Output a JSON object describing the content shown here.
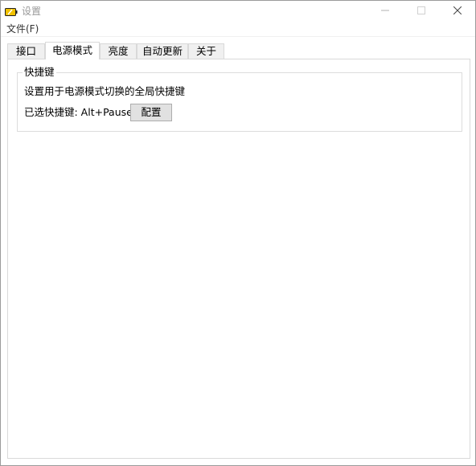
{
  "window": {
    "title": "设置",
    "app_icon": "battery-icon",
    "controls": {
      "minimize": "minimize-icon",
      "maximize": "maximize-icon",
      "close": "close-icon"
    }
  },
  "menubar": {
    "file_label": "文件(F)"
  },
  "tabs": [
    {
      "label": "接口",
      "active": false
    },
    {
      "label": "电源模式",
      "active": true
    },
    {
      "label": "亮度",
      "active": false
    },
    {
      "label": "自动更新",
      "active": false
    },
    {
      "label": "关于",
      "active": false
    }
  ],
  "hotkey_group": {
    "title": "快捷键",
    "description": "设置用于电源模式切换的全局快捷键",
    "selected_label": "已选快捷键: Alt+Pause",
    "config_button": "配置"
  },
  "colors": {
    "tab_inactive_bg": "#f0f0f0",
    "border": "#d9d9d9",
    "button_bg": "#e1e1e1",
    "title_text": "#999999",
    "battery_yellow": "#f2c200"
  }
}
